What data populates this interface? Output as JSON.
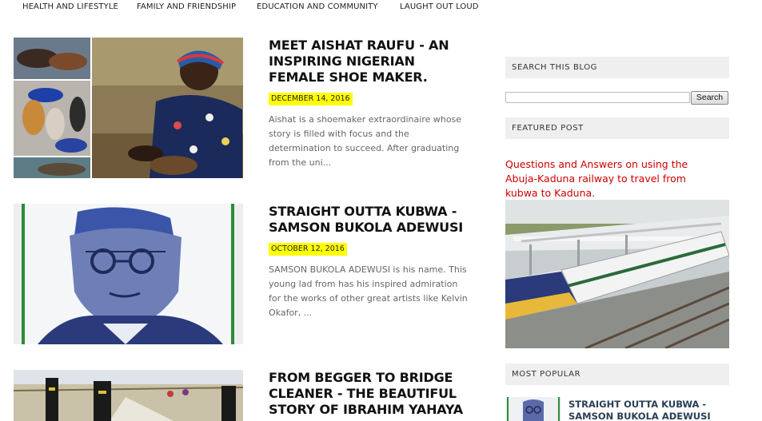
{
  "nav": {
    "items": [
      {
        "label": "HEALTH AND LIFESTYLE"
      },
      {
        "label": "FAMILY AND FRIENDSHIP"
      },
      {
        "label": "EDUCATION AND COMMUNITY"
      },
      {
        "label": "LAUGHT OUT LOUD"
      }
    ]
  },
  "posts": [
    {
      "title": "MEET AISHAT RAUFU - AN INSPIRING NIGERIAN FEMALE SHOE MAKER.",
      "date": "DECEMBER 14, 2016",
      "excerpt": "Aishat is a shoemaker extraordinaire whose story is filled with focus and the determination to succeed. After graduating from the uni..."
    },
    {
      "title": "STRAIGHT OUTTA KUBWA - SAMSON BUKOLA ADEWUSI",
      "date": "OCTOBER 12, 2016",
      "excerpt": "SAMSON BUKOLA ADEWUSI is his name. This young lad from has his inspired admiration for the works of other great artists like Kelvin Okafor, ..."
    },
    {
      "title": "FROM BEGGER TO BRIDGE CLEANER - THE BEAUTIFUL STORY OF IBRAHIM YAHAYA"
    }
  ],
  "sidebar": {
    "search_heading": "SEARCH THIS BLOG",
    "search_value": "",
    "search_button": "Search",
    "featured_heading": "FEATURED POST",
    "featured_link": "Questions and Answers on using the Abuja-Kaduna railway to travel from kubwa to Kaduna.",
    "popular_heading": "MOST POPULAR",
    "popular_title": "STRAIGHT OUTTA KUBWA - SAMSON BUKOLA ADEWUSI"
  },
  "colors": {
    "date_highlight": "#ffff00",
    "featured_link": "#cc0000",
    "sidebar_header_bg": "#efefef",
    "popular_title": "#2a3f55"
  }
}
